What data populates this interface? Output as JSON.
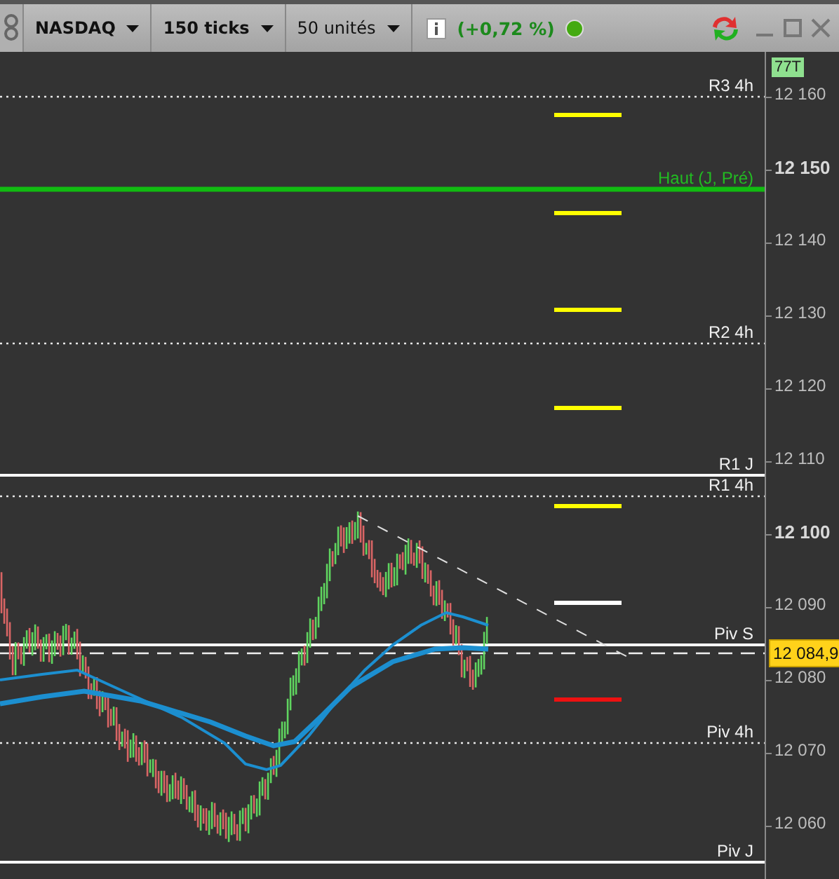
{
  "toolbar": {
    "dropdowns": [
      {
        "label": "NASDAQ",
        "bold": true
      },
      {
        "label": "150 ticks",
        "bold": true
      },
      {
        "label": "50 unités",
        "bold": false
      }
    ],
    "change": "(+0,72 %)",
    "status": {
      "color": "#44aa11"
    }
  },
  "chart": {
    "tick_badge": "77T",
    "price_badge": "12 084,9",
    "axis_ticks": [
      {
        "label": "12 160",
        "major": false
      },
      {
        "label": "12 150",
        "major": true
      },
      {
        "label": "12 140",
        "major": false
      },
      {
        "label": "12 130",
        "major": false
      },
      {
        "label": "12 120",
        "major": false
      },
      {
        "label": "12 110",
        "major": false
      },
      {
        "label": "12 100",
        "major": true
      },
      {
        "label": "12 090",
        "major": false
      },
      {
        "label": "12 080",
        "major": false
      },
      {
        "label": "12 070",
        "major": false
      },
      {
        "label": "12 060",
        "major": false
      }
    ],
    "levels": [
      {
        "label": "R3 4h",
        "kind": "dotted"
      },
      {
        "label": "Haut (J, Pré)",
        "kind": "high"
      },
      {
        "label": "R2 4h",
        "kind": "dotted"
      },
      {
        "label": "R1 J",
        "kind": "solid"
      },
      {
        "label": "R1 4h",
        "kind": "dotted"
      },
      {
        "label": "Piv S",
        "kind": "solid"
      },
      {
        "label": "Piv 4h",
        "kind": "dotted"
      },
      {
        "label": "Piv J",
        "kind": "solid"
      }
    ],
    "markers": [
      {
        "color": "#ffff00"
      },
      {
        "color": "#ffff00"
      },
      {
        "color": "#ffff00"
      },
      {
        "color": "#ffff00"
      },
      {
        "color": "#ffff00"
      },
      {
        "color": "#ffffff"
      },
      {
        "color": "#ee1111"
      }
    ]
  }
}
